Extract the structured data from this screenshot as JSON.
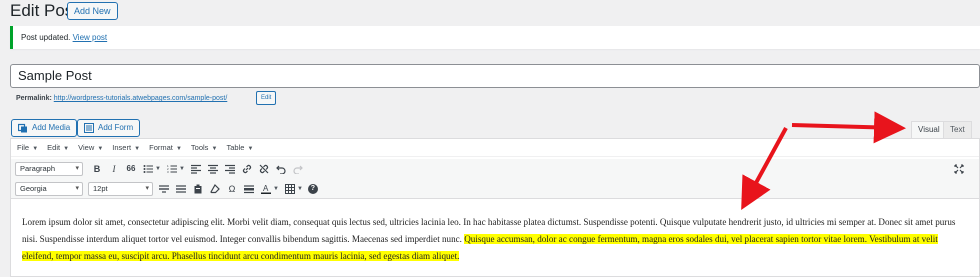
{
  "header": {
    "title": "Edit Post",
    "add_new": "Add New"
  },
  "notice": {
    "text": "Post updated.",
    "link": "View post"
  },
  "post": {
    "title": "Sample Post",
    "permalink_label": "Permalink:",
    "permalink_url": "http://wordpress-tutorials.atwebpages.com/sample-post/",
    "edit_label": "Edit"
  },
  "media": {
    "add_media": "Add Media",
    "add_form": "Add Form"
  },
  "tabs": {
    "visual": "Visual",
    "text": "Text"
  },
  "menubar": [
    "File",
    "Edit",
    "View",
    "Insert",
    "Format",
    "Tools",
    "Table"
  ],
  "toolbar": {
    "format_select": "Paragraph",
    "font_select": "Georgia",
    "size_select": "12pt",
    "bold": "B",
    "italic": "I",
    "quote": "66",
    "omega": "Ω",
    "help": "?"
  },
  "content": {
    "plain": "Lorem ipsum dolor sit amet, consectetur adipiscing elit. Morbi velit diam, consequat quis lectus sed, ultricies lacinia leo. In hac habitasse platea dictumst. Suspendisse potenti. Quisque vulputate hendrerit justo, id ultricies mi semper at. Donec sit amet purus nisi. Suspendisse interdum aliquet tortor vel euismod. Integer convallis bibendum sagittis. Maecenas sed imperdiet nunc. ",
    "highlighted": "Quisque accumsan, dolor ac congue fermentum, magna eros sodales dui, vel placerat sapien tortor vitae lorem. Vestibulum at velit eleifend, tempor massa eu, suscipit arcu. Phasellus tincidunt arcu condimentum mauris lacinia, sed egestas diam aliquet."
  },
  "colors": {
    "accent": "#2271b1",
    "success": "#00a32a",
    "arrow": "#e8141c",
    "highlight": "#ffff00"
  }
}
